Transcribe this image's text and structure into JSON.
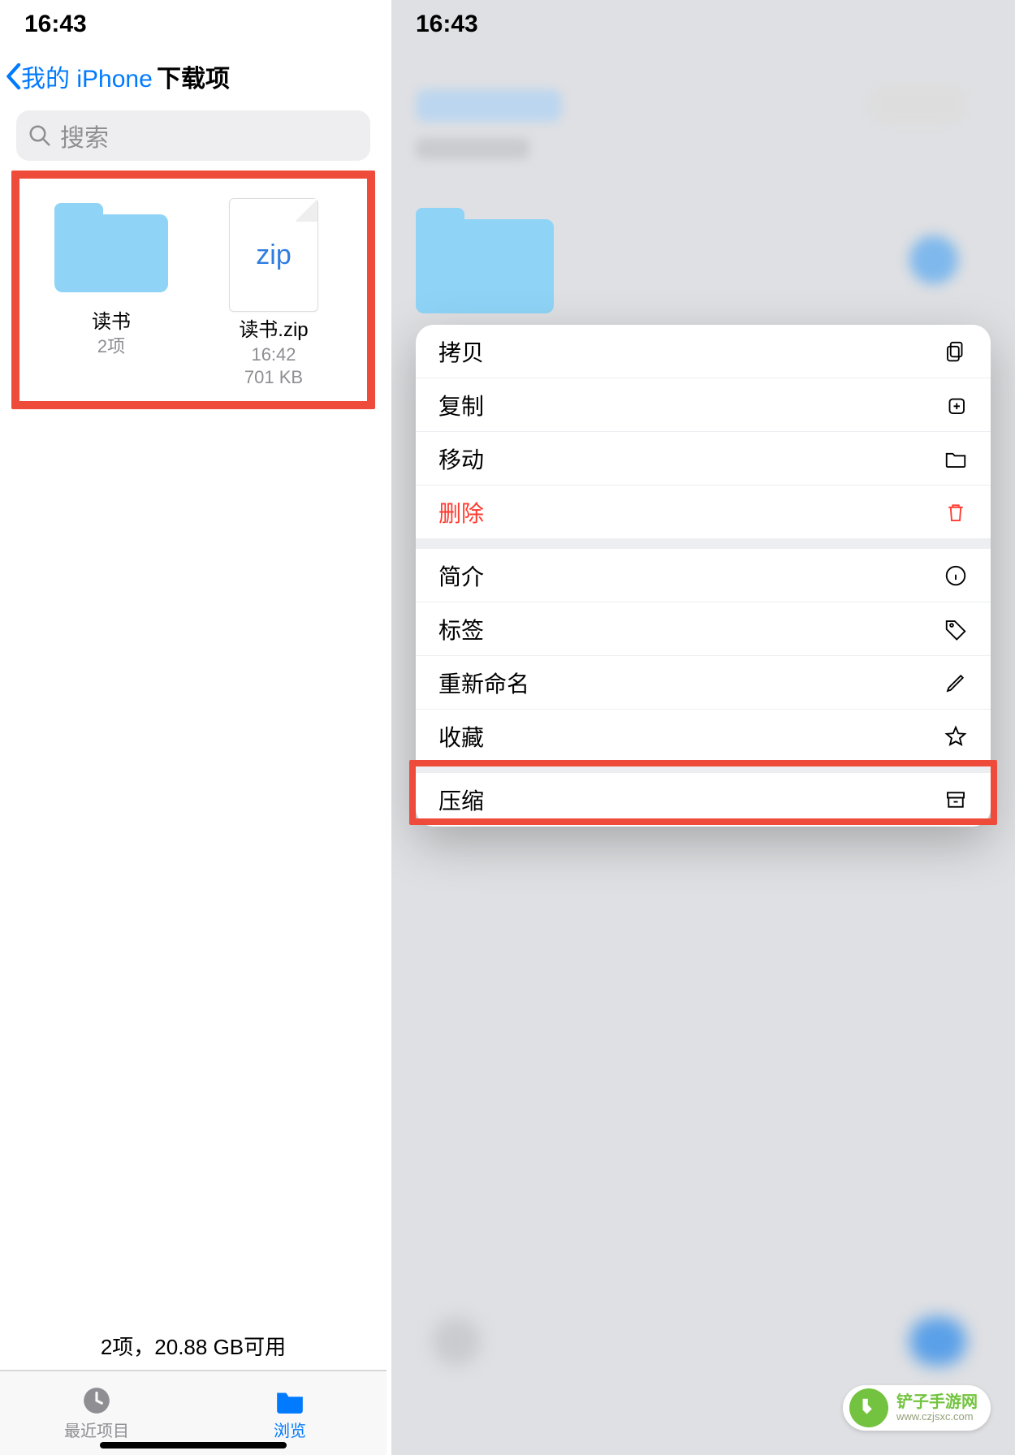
{
  "left": {
    "status_time": "16:43",
    "back_label": "我的 iPhone",
    "title": "下载项",
    "search_placeholder": "搜索",
    "items": [
      {
        "name": "读书",
        "meta1": "2项",
        "meta2": ""
      },
      {
        "name": "读书.zip",
        "meta1": "16:42",
        "meta2": "701 KB"
      }
    ],
    "zip_label": "zip",
    "summary": "2项，20.88 GB可用",
    "tabs": {
      "recents": "最近项目",
      "browse": "浏览"
    }
  },
  "right": {
    "status_time": "16:43",
    "menu": {
      "copy": "拷贝",
      "duplicate": "复制",
      "move": "移动",
      "delete": "删除",
      "info": "简介",
      "tags": "标签",
      "rename": "重新命名",
      "favorite": "收藏",
      "compress": "压缩"
    }
  },
  "watermark": {
    "line1": "铲子手游网",
    "line2": "www.czjsxc.com"
  }
}
